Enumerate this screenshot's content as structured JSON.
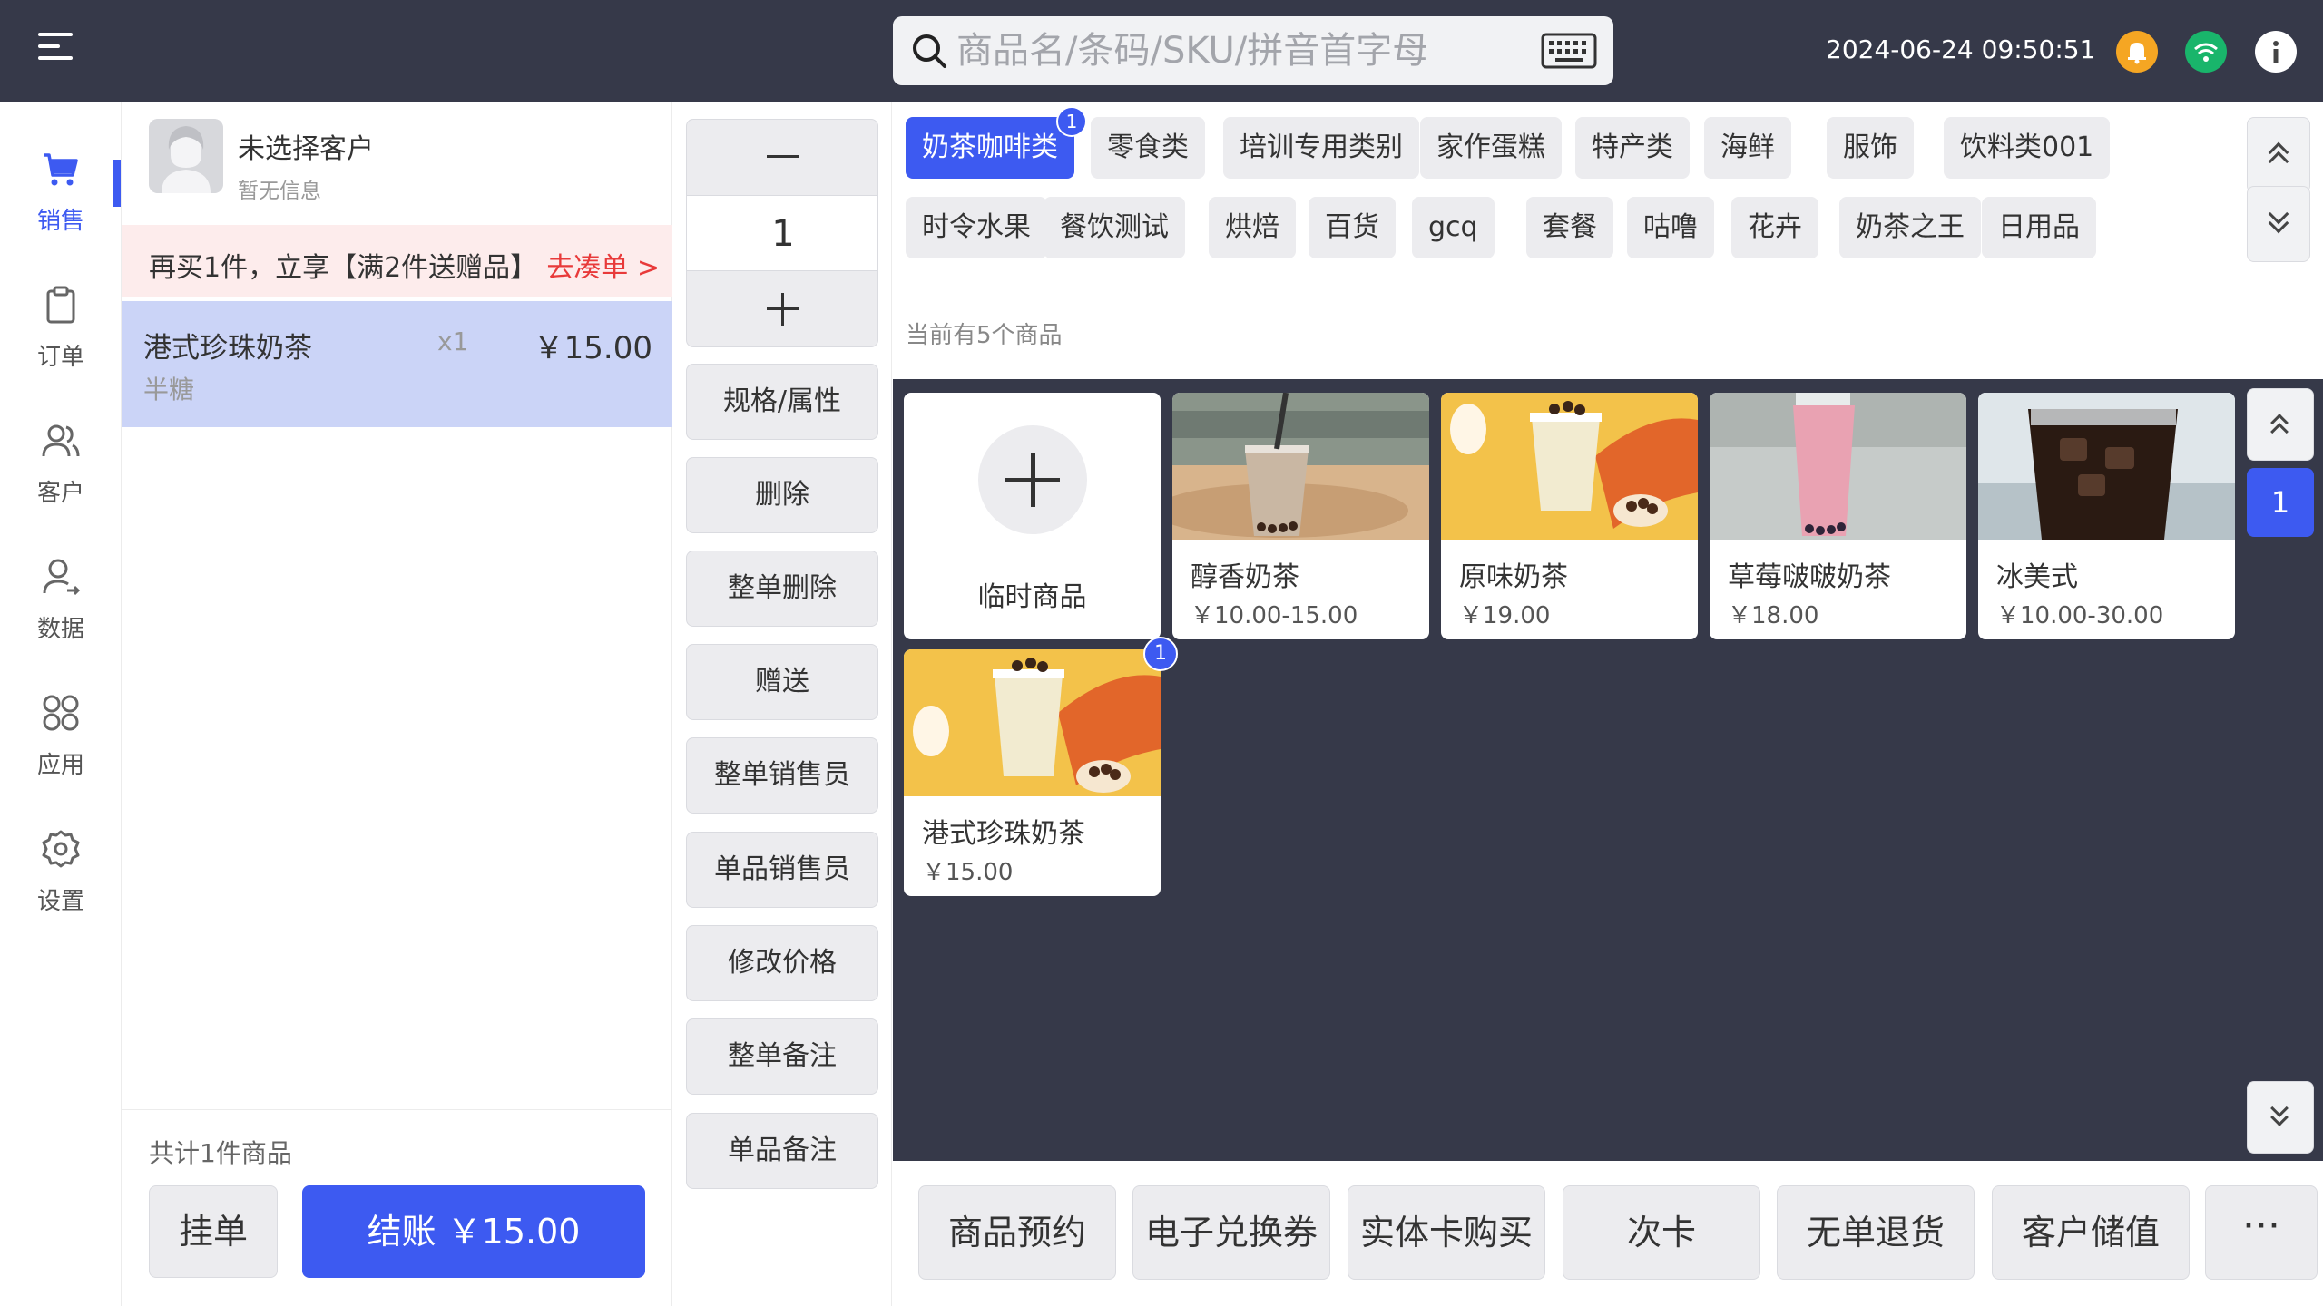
{
  "topbar": {
    "search_placeholder": "商品名/条码/SKU/拼音首字母",
    "datetime": "2024-06-24 09:50:51",
    "icons": [
      "menu-icon",
      "search-icon",
      "keyboard-icon",
      "bell-icon",
      "wifi-icon",
      "info-icon"
    ]
  },
  "nav": {
    "active_color": "#3d5af1",
    "items": [
      {
        "label": "销售",
        "icon": "cart-icon"
      },
      {
        "label": "订单",
        "icon": "clipboard-icon"
      },
      {
        "label": "客户",
        "icon": "users-icon"
      },
      {
        "label": "数据",
        "icon": "data-user-icon"
      },
      {
        "label": "应用",
        "icon": "apps-icon"
      },
      {
        "label": "设置",
        "icon": "gear-icon"
      }
    ]
  },
  "order": {
    "customer_name": "未选择客户",
    "customer_sub": "暂无信息",
    "promo_text": "再买1件，立享【满2件送赠品】",
    "promo_link": "去凑单 >",
    "lines": [
      {
        "name": "港式珍珠奶茶",
        "qty": "x1",
        "price": "￥15.00",
        "spec": "半糖"
      }
    ],
    "total_count": "共计1件商品",
    "hold_label": "挂单",
    "pay_label": "结账 ￥15.00"
  },
  "ops": {
    "quantity": "1",
    "buttons": [
      "规格/属性",
      "删除",
      "整单删除",
      "赠送",
      "整单销售员",
      "单品销售员",
      "修改价格",
      "整单备注",
      "单品备注"
    ]
  },
  "categories": {
    "row1": [
      "奶茶咖啡类",
      "零食类",
      "培训专用类别",
      "家作蛋糕",
      "特产类",
      "海鲜",
      "服饰",
      "饮料类001"
    ],
    "row2": [
      "时令水果",
      "餐饮测试",
      "烘焙",
      "百货",
      "gcq",
      "套餐",
      "咕噜",
      "花卉",
      "奶茶之王",
      "日用品"
    ],
    "active_badge": "1"
  },
  "products": {
    "count_text": "当前有5个商品",
    "temp_label": "临时商品",
    "items": [
      {
        "name": "醇香奶茶",
        "price": "￥10.00-15.00"
      },
      {
        "name": "原味奶茶",
        "price": "￥19.00"
      },
      {
        "name": "草莓啵啵奶茶",
        "price": "￥18.00"
      },
      {
        "name": "冰美式",
        "price": "￥10.00-30.00"
      },
      {
        "name": "港式珍珠奶茶",
        "price": "￥15.00",
        "badge": "1"
      }
    ],
    "page": "1"
  },
  "actions": {
    "buttons": [
      "商品预约",
      "电子兑换券",
      "实体卡购买",
      "次卡",
      "无单退货",
      "客户储值"
    ],
    "more": "···"
  }
}
